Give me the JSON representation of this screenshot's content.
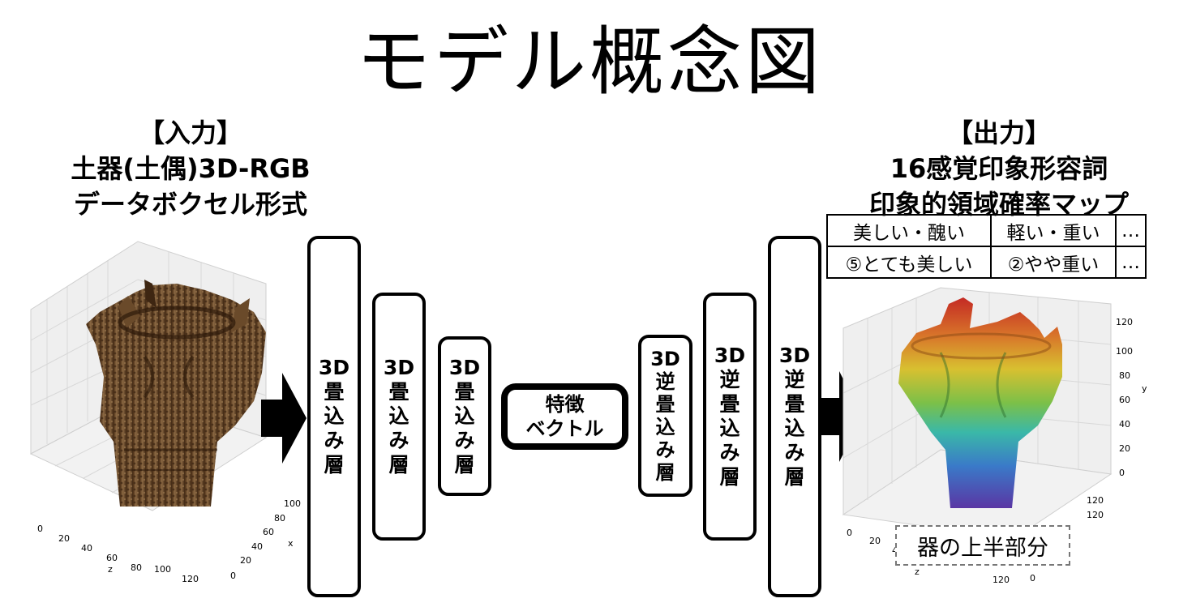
{
  "title": "モデル概念図",
  "input": {
    "heading": "【入力】",
    "line1": "土器(土偶)3D-RGB",
    "line2": "データボクセル形式",
    "plot": {
      "x_axis_label": "x",
      "z_axis_label": "z",
      "z_ticks": [
        "0",
        "20",
        "40",
        "60",
        "80",
        "100",
        "120"
      ],
      "x_ticks": [
        "0",
        "20",
        "40",
        "60",
        "80",
        "100"
      ]
    }
  },
  "encoder_layers": [
    {
      "lines": [
        "3D",
        "畳",
        "込",
        "み",
        "層"
      ]
    },
    {
      "lines": [
        "3D",
        "畳",
        "込",
        "み",
        "層"
      ]
    },
    {
      "lines": [
        "3D",
        "畳",
        "込",
        "み",
        "層"
      ]
    }
  ],
  "feature_vector": {
    "line1": "特徴",
    "line2": "ベクトル"
  },
  "decoder_layers": [
    {
      "lines": [
        "3D",
        "逆",
        "畳",
        "込",
        "み",
        "層"
      ]
    },
    {
      "lines": [
        "3D",
        "逆",
        "畳",
        "込",
        "み",
        "層"
      ]
    },
    {
      "lines": [
        "3D",
        "逆",
        "畳",
        "込",
        "み",
        "層"
      ]
    }
  ],
  "output": {
    "heading": "【出力】",
    "line1": "16感覚印象形容詞",
    "line2": "印象的領域確率マップ",
    "table": {
      "row1": [
        "美しい・醜い",
        "軽い・重い",
        "…"
      ],
      "row2": [
        "⑤とても美しい",
        "②やや重い",
        "…"
      ]
    },
    "plot": {
      "y_axis_label": "y",
      "z_axis_label": "z",
      "y_ticks": [
        "0",
        "20",
        "40",
        "60",
        "80",
        "100",
        "120"
      ],
      "x_ticks": [
        "120",
        "0"
      ],
      "z_ticks_visible": [
        "0",
        "20",
        "40"
      ]
    },
    "region_label": "器の上半部分"
  },
  "colors": {
    "pottery_dark": "#5a3a1e",
    "pottery_mid": "#8a6038",
    "heatmap_top": "#c0302a",
    "heatmap_bottom": "#4a3aa8"
  }
}
